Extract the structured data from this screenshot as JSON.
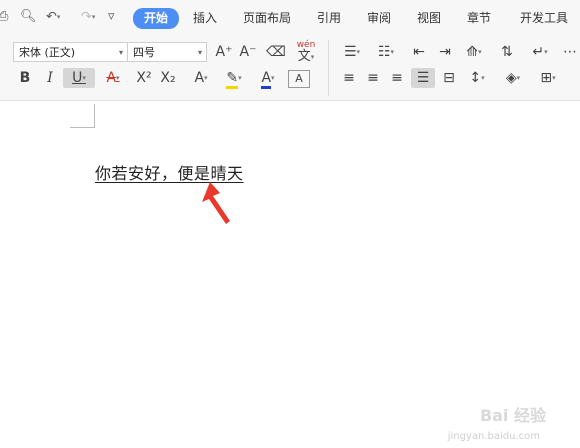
{
  "quick_access": {
    "items": [
      "save-icon",
      "print-preview-icon",
      "undo-icon",
      "redo-icon",
      "customize-icon"
    ]
  },
  "tabs": [
    {
      "label": "开始",
      "active": true
    },
    {
      "label": "插入"
    },
    {
      "label": "页面布局"
    },
    {
      "label": "引用"
    },
    {
      "label": "审阅"
    },
    {
      "label": "视图"
    },
    {
      "label": "章节"
    },
    {
      "label": "开发工具"
    }
  ],
  "font": {
    "family_value": "宋体 (正文)",
    "size_value": "四号",
    "bold_glyph": "B",
    "italic_glyph": "I",
    "underline_glyph": "U",
    "strikethrough_glyph": "A",
    "superscript_glyph": "X²",
    "subscript_glyph": "X₂",
    "effect_glyph": "A",
    "font_color_glyph": "A",
    "char_border_glyph": "A",
    "grow_glyph": "A⁺",
    "shrink_glyph": "A⁻",
    "phonetic_glyph": "wén\n文"
  },
  "document": {
    "text": "你若安好，便是晴天"
  },
  "colors": {
    "accent": "#4d8ef5",
    "arrow": "#e8392c",
    "font_color_bar": "#1d3fd1",
    "highlight_bar": "#f2d600"
  },
  "watermark": {
    "text": "Bai 经验",
    "url": "jingyan.baidu.com"
  }
}
